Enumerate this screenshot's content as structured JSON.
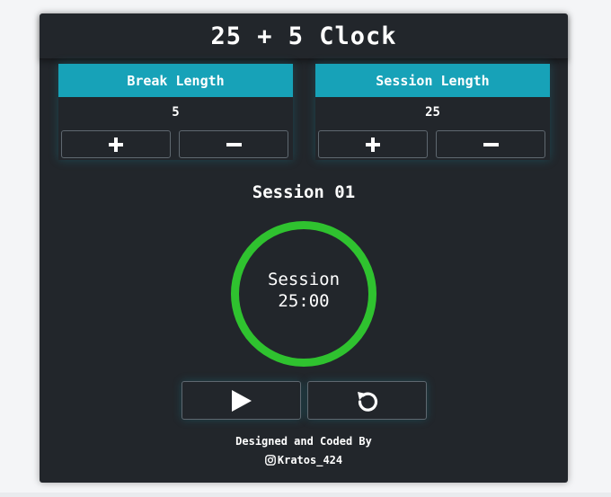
{
  "app": {
    "title": "25 + 5 Clock"
  },
  "break_panel": {
    "label": "Break Length",
    "value": "5",
    "increment_icon": "plus-icon",
    "decrement_icon": "minus-icon"
  },
  "session_panel": {
    "label": "Session Length",
    "value": "25",
    "increment_icon": "plus-icon",
    "decrement_icon": "minus-icon"
  },
  "timer": {
    "session_counter": "Session 01",
    "mode": "Session",
    "time": "25:00",
    "ring_color": "#2fc22f"
  },
  "controls": {
    "play_icon": "play-icon",
    "reset_icon": "reset-icon"
  },
  "footer": {
    "line1": "Designed and Coded By",
    "handle": "Kratos_424",
    "social_icon": "instagram-icon"
  },
  "colors": {
    "accent": "#17a2b8",
    "background": "#22262b",
    "ring": "#2fc22f"
  }
}
